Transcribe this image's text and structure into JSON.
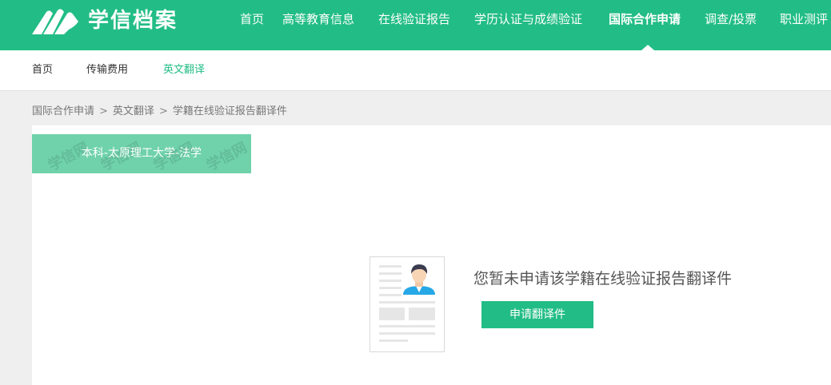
{
  "brand": {
    "name": "学信档案",
    "primary_color": "#22bd86",
    "tab_color": "#6fd2ab"
  },
  "main_nav": [
    {
      "label": "首页"
    },
    {
      "label": "高等教育信息"
    },
    {
      "label": "在线验证报告"
    },
    {
      "label": "学历认证与成绩验证"
    },
    {
      "label": "国际合作申请",
      "active": true
    },
    {
      "label": "调查/投票"
    },
    {
      "label": "职业测评"
    }
  ],
  "sub_nav": [
    {
      "label": "首页"
    },
    {
      "label": "传输费用"
    },
    {
      "label": "英文翻译",
      "active": true
    }
  ],
  "breadcrumb": {
    "items": [
      "国际合作申请",
      "英文翻译",
      "学籍在线验证报告翻译件"
    ],
    "separator": ">"
  },
  "record_tab": {
    "label": "本科-太原理工大学-法学",
    "watermark": "学信网"
  },
  "empty_state": {
    "message": "您暂未申请该学籍在线验证报告翻译件",
    "button_label": "申请翻译件",
    "illustration_icon": "document-person-icon"
  }
}
